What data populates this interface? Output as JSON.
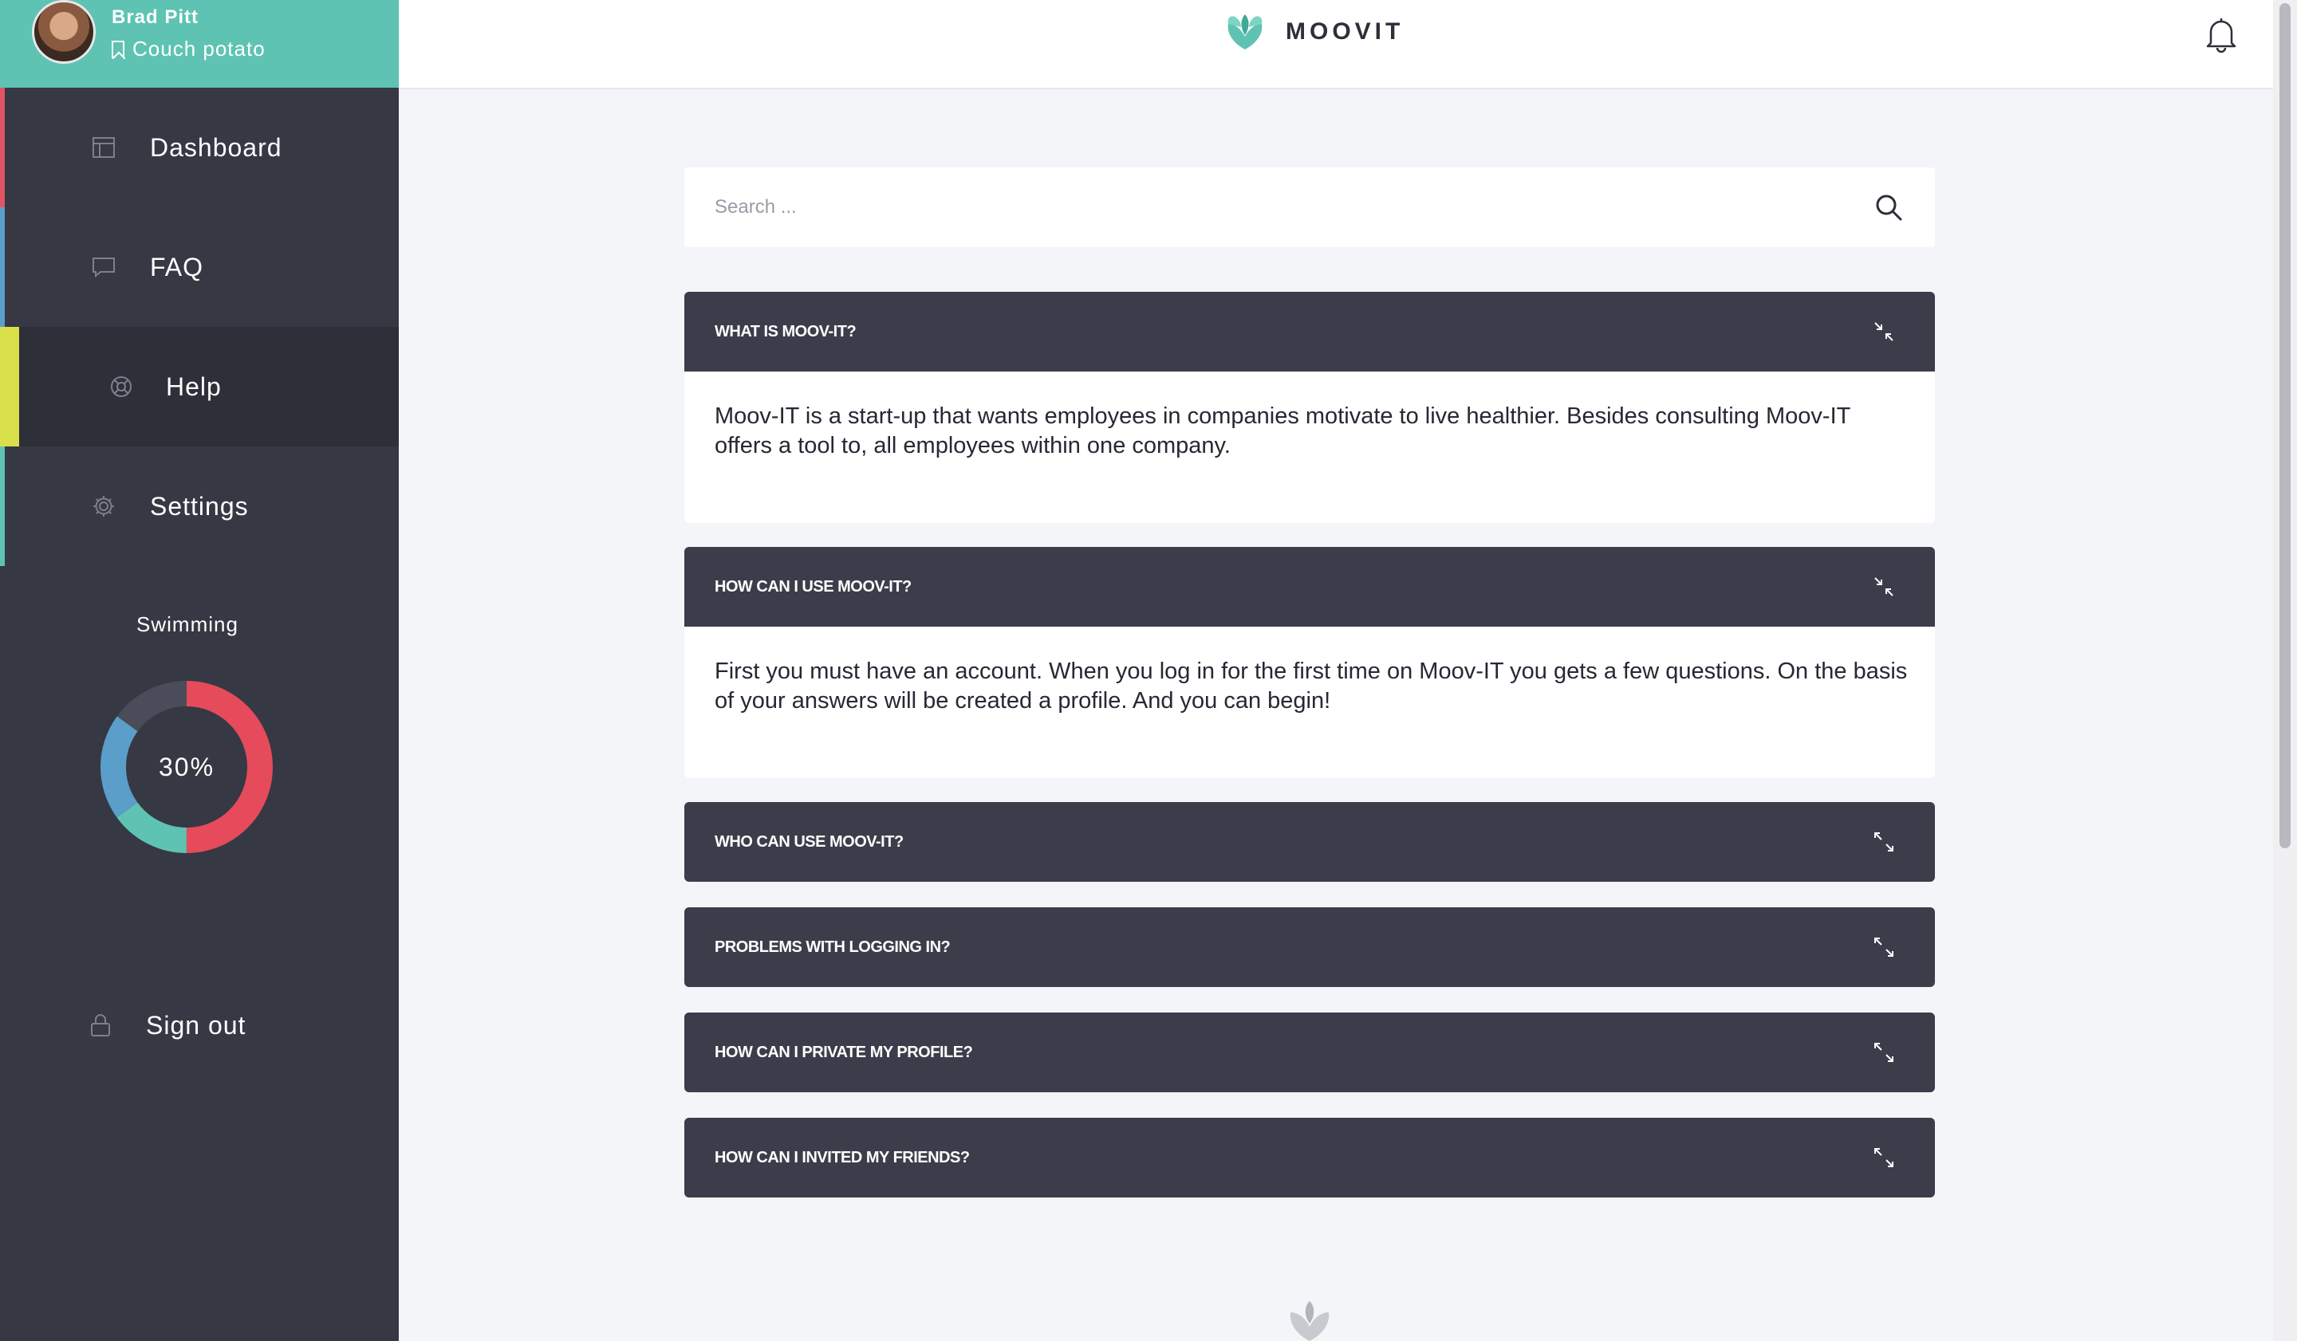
{
  "profile": {
    "name": "Brad Pitt",
    "status": "Couch potato"
  },
  "nav": [
    {
      "label": "Dashboard",
      "icon": "dashboard-icon",
      "color": "#e05463"
    },
    {
      "label": "FAQ",
      "icon": "chat-icon",
      "color": "#5a9ec9"
    },
    {
      "label": "Help",
      "icon": "lifebuoy-icon",
      "color": "#d9e04a",
      "active": true
    },
    {
      "label": "Settings",
      "icon": "gear-icon",
      "color": "#5ec3b2"
    }
  ],
  "activity": {
    "label": "Swimming",
    "progress_text": "30%",
    "segments": [
      {
        "color": "#e54b5a",
        "fraction": 0.5
      },
      {
        "color": "#5ec3b2",
        "fraction": 0.15
      },
      {
        "color": "#5a9ec9",
        "fraction": 0.2
      },
      {
        "color": "#4a4c5a",
        "fraction": 0.15
      }
    ]
  },
  "signout": {
    "label": "Sign out",
    "icon": "lock-icon"
  },
  "header": {
    "brand": "MOOVIT",
    "logo": "moovit-logo-icon",
    "bell": "bell-icon"
  },
  "search": {
    "placeholder": "Search ...",
    "icon": "search-icon"
  },
  "faq": [
    {
      "question": "WHAT IS MOOV-IT?",
      "answer": "Moov-IT is a start-up that wants employees in companies motivate to live healthier. Besides consulting Moov-IT offers a tool to, all employees within one company.",
      "expanded": true,
      "icon": "collapse-icon"
    },
    {
      "question": "HOW CAN I USE MOOV-IT?",
      "answer": "First you must have an account. When you log in for the first time on Moov-IT you gets a few questions. On the basis of your answers will be created a profile. And you can begin!",
      "expanded": true,
      "icon": "collapse-icon"
    },
    {
      "question": "WHO CAN USE MOOV-IT?",
      "expanded": false,
      "icon": "expand-icon"
    },
    {
      "question": "PROBLEMS WITH LOGGING IN?",
      "expanded": false,
      "icon": "expand-icon"
    },
    {
      "question": "HOW CAN I PRIVATE MY PROFILE?",
      "expanded": false,
      "icon": "expand-icon"
    },
    {
      "question": "HOW CAN I INVITED MY FRIENDS?",
      "expanded": false,
      "icon": "expand-icon"
    }
  ]
}
